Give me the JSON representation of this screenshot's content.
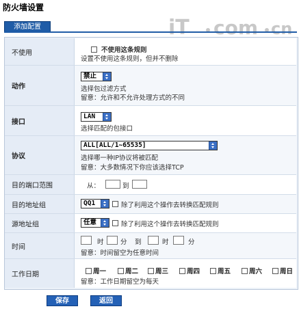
{
  "page_title": "防火墙设置",
  "tab_label": "添加配置",
  "rows": {
    "disable": {
      "label": "不使用",
      "checkbox_label": "不使用这条规则",
      "hint": "设置不使用这条规则，但并不删除"
    },
    "action": {
      "label": "动作",
      "selected": "禁止",
      "hint1": "选择包过滤方式",
      "hint2": "留意：允许和不允许处理方式的不同"
    },
    "interface": {
      "label": "接口",
      "selected": "LAN",
      "hint": "选择匹配的包接口"
    },
    "protocol": {
      "label": "协议",
      "selected": "ALL[ALL/1~65535]",
      "hint1": "选择哪一种IP协议将被匹配",
      "hint2": "留意：大多数情况下你应该选择TCP"
    },
    "port_range": {
      "label": "目的端口范围",
      "from_label": "从：",
      "to_label": "到"
    },
    "dest_addr": {
      "label": "目的地址组",
      "selected": "QQ1",
      "except_label": "除了利用这个操作去转换匹配规则"
    },
    "src_addr": {
      "label": "源地址组",
      "selected": "任意",
      "except_label": "除了利用这个操作去转换匹配规则"
    },
    "time": {
      "label": "时间",
      "hour1": "时",
      "min1": "分",
      "to": "到",
      "hour2": "时",
      "min2": "分",
      "hint": "留意：时间留空为任意时间"
    },
    "workdays": {
      "label": "工作日期",
      "days": [
        "周一",
        "周二",
        "周三",
        "周四",
        "周五",
        "周六",
        "周日"
      ],
      "hint": "留意：工作日期留空为每天"
    }
  },
  "buttons": {
    "save": "保存",
    "back": "返回"
  },
  "colors": {
    "accent": "#1f5ca7",
    "label_bg": "#e5ecf6",
    "select_arrow": "#3b6fc4"
  },
  "icons": [
    "select-arrow-icon",
    "checkbox-icon"
  ]
}
